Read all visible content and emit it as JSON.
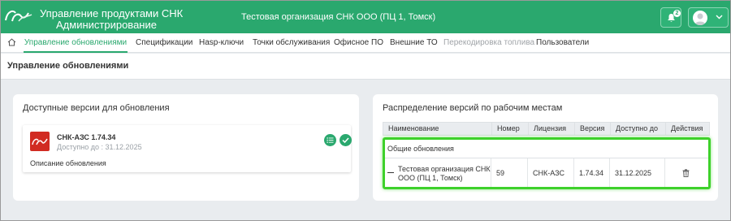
{
  "header": {
    "title": "Управление продуктами СНК",
    "subtitle": "Администрирование",
    "organization": "Тестовая организация СНК ООО (ПЦ 1, Томск)",
    "notifications_count": "2",
    "accent_color": "#2aa86e"
  },
  "nav": {
    "items": [
      {
        "label": "Управление обновлениями",
        "active": true
      },
      {
        "label": "Спецификации"
      },
      {
        "label": "Hasp-ключи"
      },
      {
        "label": "Точки обслуживания"
      },
      {
        "label": "Офисное ПО"
      },
      {
        "label": "Внешние ТО"
      },
      {
        "label": "Перекодировка топлива",
        "disabled": true
      },
      {
        "label": "Пользователи"
      }
    ]
  },
  "page": {
    "title": "Управление обновлениями"
  },
  "available": {
    "title": "Доступные версии для обновления",
    "version": {
      "name": "СНК-АЗС 1.74.34",
      "available_until": "Доступно до : 31.12.2025",
      "description": "Описание обновления"
    }
  },
  "distribution": {
    "title": "Распределение версий по рабочим местам",
    "columns": [
      "Наименование",
      "Номер",
      "Лицензия",
      "Версия",
      "Доступно до",
      "Действия"
    ],
    "group": "Общие обновления",
    "row": {
      "name_line1": "Тестовая организация СНК",
      "name_line2": "ООО (ПЦ 1, Томск)",
      "number": "59",
      "license": "СНК-АЗС",
      "version": "1.74.34",
      "available_until": "31.12.2025"
    }
  }
}
